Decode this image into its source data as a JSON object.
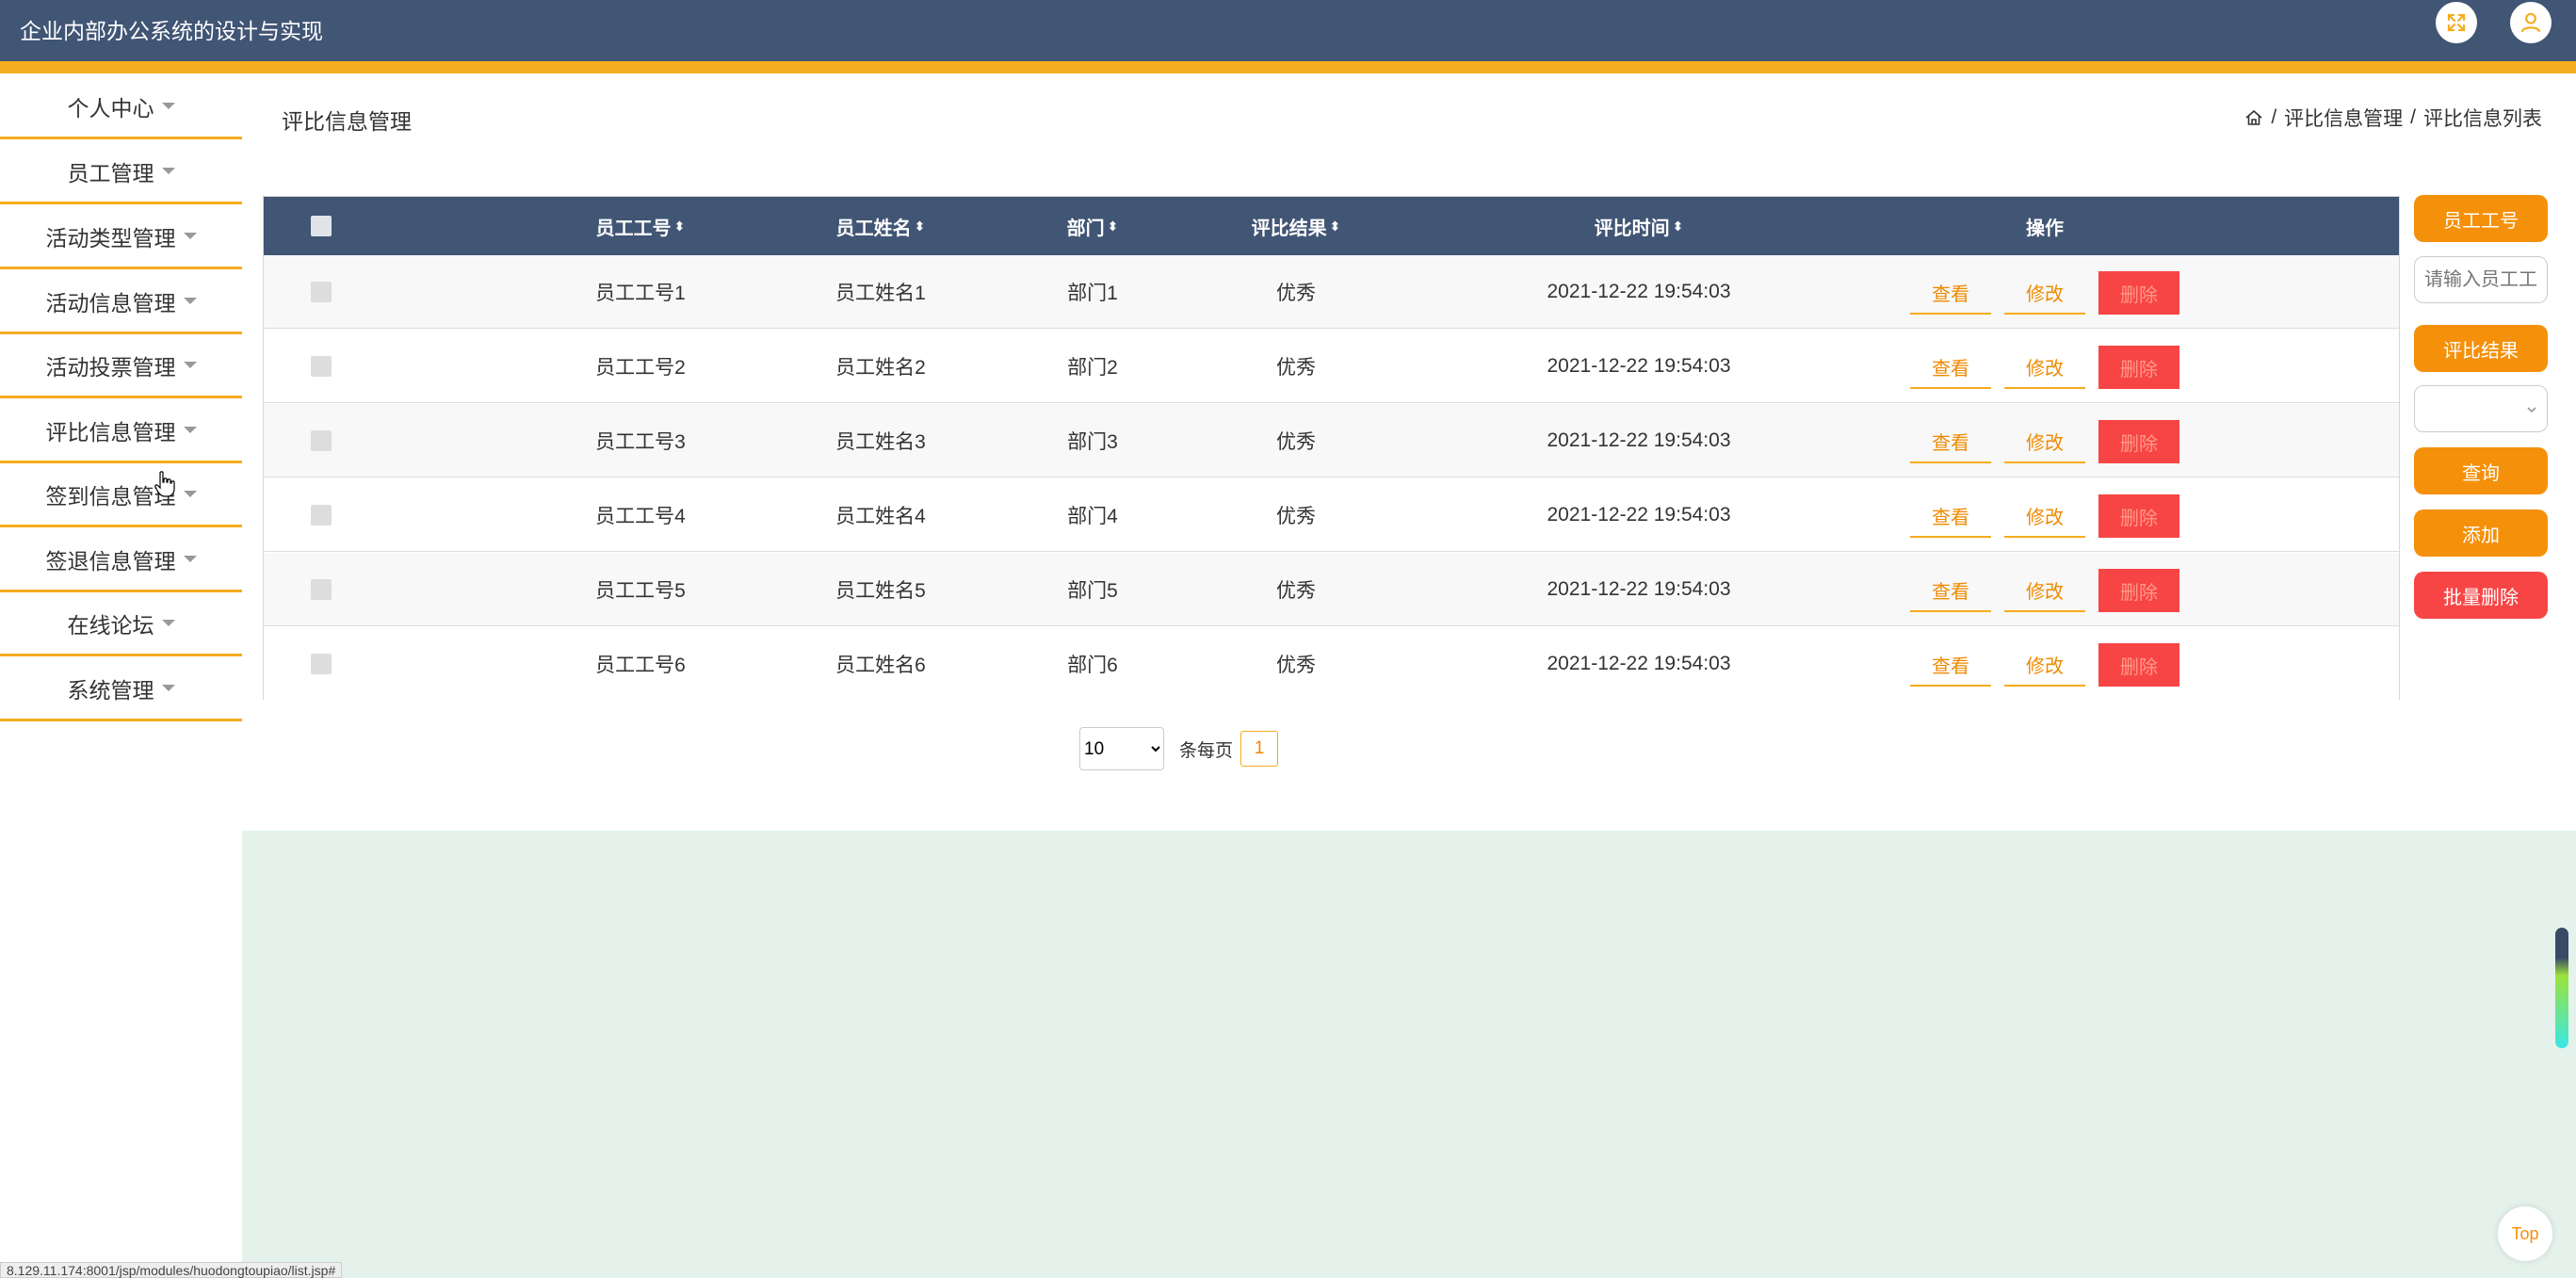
{
  "header": {
    "title": "企业内部办公系统的设计与实现",
    "fullscreen_icon": "fullscreen-icon",
    "user_icon": "user-icon"
  },
  "colors": {
    "topbar": "#415574",
    "accent": "#f5ac1e",
    "orange": "#f5900a",
    "delete": "#f74545",
    "content_bg": "#e5f2ec"
  },
  "sidebar": {
    "items": [
      {
        "label": "个人中心"
      },
      {
        "label": "员工管理"
      },
      {
        "label": "活动类型管理"
      },
      {
        "label": "活动信息管理"
      },
      {
        "label": "活动投票管理"
      },
      {
        "label": "评比信息管理"
      },
      {
        "label": "签到信息管理"
      },
      {
        "label": "签退信息管理"
      },
      {
        "label": "在线论坛"
      },
      {
        "label": "系统管理"
      }
    ]
  },
  "page": {
    "title": "评比信息管理",
    "breadcrumb": [
      "评比信息管理",
      "评比信息列表"
    ]
  },
  "table": {
    "headers": [
      "员工工号",
      "员工姓名",
      "部门",
      "评比结果",
      "评比时间",
      "操作"
    ],
    "rows": [
      {
        "id": "员工工号1",
        "name": "员工姓名1",
        "dept": "部门1",
        "result": "优秀",
        "time": "2021-12-22 19:54:03"
      },
      {
        "id": "员工工号2",
        "name": "员工姓名2",
        "dept": "部门2",
        "result": "优秀",
        "time": "2021-12-22 19:54:03"
      },
      {
        "id": "员工工号3",
        "name": "员工姓名3",
        "dept": "部门3",
        "result": "优秀",
        "time": "2021-12-22 19:54:03"
      },
      {
        "id": "员工工号4",
        "name": "员工姓名4",
        "dept": "部门4",
        "result": "优秀",
        "time": "2021-12-22 19:54:03"
      },
      {
        "id": "员工工号5",
        "name": "员工姓名5",
        "dept": "部门5",
        "result": "优秀",
        "time": "2021-12-22 19:54:03"
      },
      {
        "id": "员工工号6",
        "name": "员工姓名6",
        "dept": "部门6",
        "result": "优秀",
        "time": "2021-12-22 19:54:03"
      }
    ],
    "actions": {
      "view": "查看",
      "edit": "修改",
      "delete": "删除"
    }
  },
  "pager": {
    "page_size": "10",
    "per_page_label": "条每页",
    "current_page": "1"
  },
  "search_panel": {
    "id_label": "员工工号",
    "id_placeholder": "请输入员工工号",
    "result_label": "评比结果",
    "query_button": "查询",
    "add_button": "添加",
    "batch_delete_button": "批量删除"
  },
  "top_button": "Top",
  "status_url": "8.129.11.174:8001/jsp/modules/huodongtoupiao/list.jsp#"
}
